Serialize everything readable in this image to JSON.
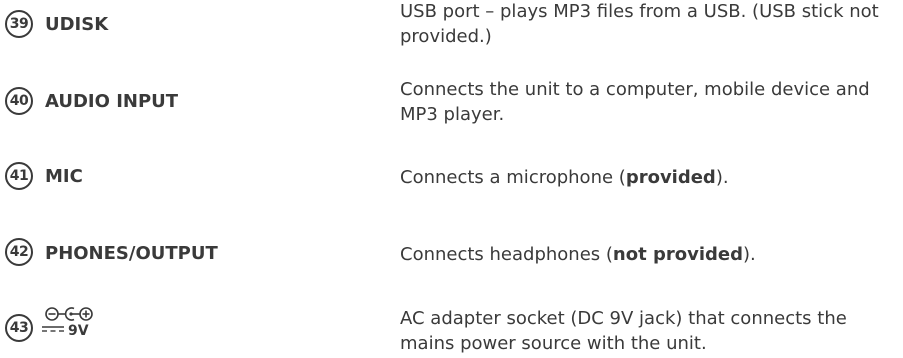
{
  "items": [
    {
      "number": "39",
      "label": "UDISK",
      "description": "USB port – plays MP3 files from a USB. (USB stick not provided.)"
    },
    {
      "number": "40",
      "label": "AUDIO INPUT",
      "description": "Connects the unit to a computer, mobile device and MP3 player."
    },
    {
      "number": "41",
      "label": "MIC",
      "description_before": "Connects a microphone (",
      "description_bold": "provided",
      "description_after": ")."
    },
    {
      "number": "42",
      "label": "PHONES/OUTPUT",
      "description_before": "Connects headphones (",
      "description_bold": "not provided",
      "description_after": ")."
    },
    {
      "number": "43",
      "symbol_icon": "dc-polarity-symbol-icon",
      "symbol_text": "9V",
      "description": "AC adapter socket (DC 9V jack) that connects the mains power source with the unit."
    }
  ]
}
